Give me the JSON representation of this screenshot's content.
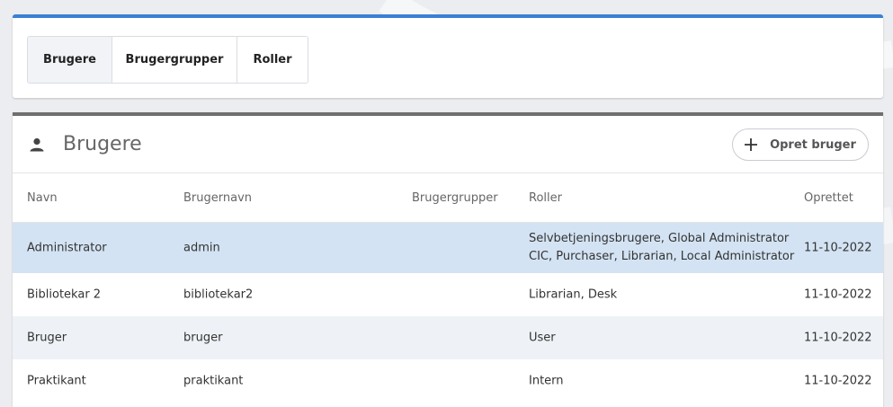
{
  "tabs": [
    {
      "label": "Brugere",
      "active": true
    },
    {
      "label": "Brugergrupper",
      "active": false
    },
    {
      "label": "Roller",
      "active": false
    }
  ],
  "panel": {
    "title": "Brugere",
    "title_icon": "person-icon",
    "create_button": {
      "icon": "plus-icon",
      "label": "Opret bruger"
    }
  },
  "table": {
    "columns": [
      "Navn",
      "Brugernavn",
      "Brugergrupper",
      "Roller",
      "Oprettet"
    ],
    "rows": [
      {
        "name": "Administrator",
        "username": "admin",
        "groups": "",
        "roles_line1": "Selvbetjeningsbrugere, Global Administrator",
        "roles_line2": "CIC, Purchaser, Librarian, Local Administrator",
        "created": "11-10-2022"
      },
      {
        "name": "Bibliotekar 2",
        "username": "bibliotekar2",
        "groups": "",
        "roles_line1": "Librarian, Desk",
        "created": "11-10-2022"
      },
      {
        "name": "Bruger",
        "username": "bruger",
        "groups": "",
        "roles_line1": "User",
        "created": "11-10-2022"
      },
      {
        "name": "Praktikant",
        "username": "praktikant",
        "groups": "",
        "roles_line1": "Intern",
        "created": "11-10-2022"
      }
    ]
  },
  "colors": {
    "accent_blue": "#3b7fd4",
    "selected_row": "#d3e3f3",
    "alt_row": "#eef2f6",
    "panel_border": "#6f6f6f"
  }
}
